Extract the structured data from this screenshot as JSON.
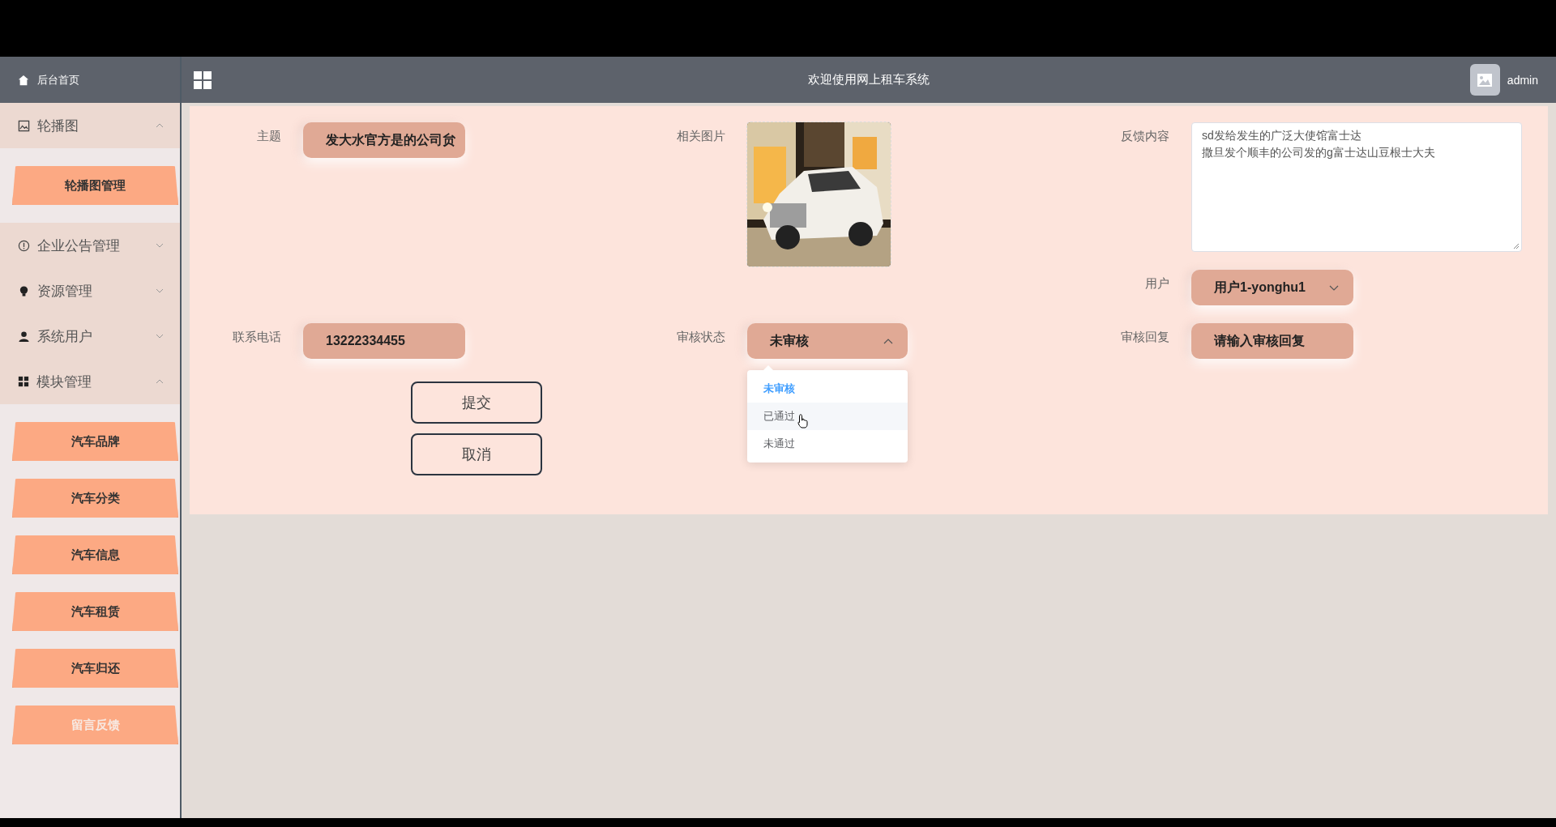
{
  "header": {
    "home": "后台首页",
    "title": "欢迎使用网上租车系统",
    "user": "admin"
  },
  "sidebar": {
    "items": [
      {
        "label": "轮播图",
        "expanded": true,
        "children": [
          {
            "label": "轮播图管理",
            "selected": false
          }
        ]
      },
      {
        "label": "企业公告管理",
        "expanded": false
      },
      {
        "label": "资源管理",
        "expanded": false
      },
      {
        "label": "系统用户",
        "expanded": false
      },
      {
        "label": "模块管理",
        "expanded": true,
        "children": [
          {
            "label": "汽车品牌",
            "selected": false
          },
          {
            "label": "汽车分类",
            "selected": false
          },
          {
            "label": "汽车信息",
            "selected": false
          },
          {
            "label": "汽车租赁",
            "selected": false
          },
          {
            "label": "汽车归还",
            "selected": false
          },
          {
            "label": "留言反馈",
            "selected": true
          }
        ]
      }
    ]
  },
  "form": {
    "fields": [
      {
        "kind": "input",
        "label": "主题",
        "value": "发大水官方是的公司贠"
      },
      {
        "label": "相关图片"
      },
      {
        "kind": "textarea",
        "label": "反馈内容",
        "lines": [
          "sd发给发生的广泛大使馆富士达",
          "撒旦发个顺丰的公司发的g富士达山豆根士大夫"
        ]
      },
      {
        "kind": "select",
        "label": "用户",
        "value": "用户1-yonghu1",
        "expanded": false
      },
      {
        "kind": "input",
        "label": "联系电话",
        "value": "13222334455"
      },
      {
        "kind": "select",
        "label": "审核状态",
        "value": "未审核",
        "expanded": true,
        "options": [
          {
            "label": "未审核",
            "selected": true,
            "hovered": false
          },
          {
            "label": "已通过",
            "selected": false,
            "hovered": true
          },
          {
            "label": "未通过",
            "selected": false,
            "hovered": false
          }
        ]
      },
      {
        "kind": "input",
        "label": "审核回复",
        "placeholder": "请输入审核回复"
      }
    ],
    "buttons": [
      "提交",
      "取消"
    ]
  }
}
